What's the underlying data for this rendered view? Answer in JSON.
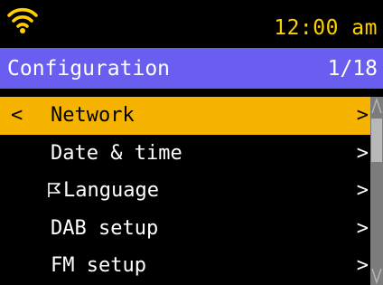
{
  "status_bar": {
    "time": "12:00 am",
    "wifi_icon": "wifi-icon"
  },
  "header": {
    "title": "Configuration",
    "page_indicator": "1/18"
  },
  "menu": {
    "back_glyph": "<",
    "item_arrow": ">",
    "items": [
      {
        "label": "Network",
        "selected": true
      },
      {
        "label": "Date & time",
        "selected": false
      },
      {
        "label": "Language",
        "selected": false,
        "icon": "flag-icon"
      },
      {
        "label": "DAB setup",
        "selected": false
      },
      {
        "label": "FM setup",
        "selected": false
      }
    ]
  },
  "colors": {
    "background": "#000000",
    "accent_clock": "#ffd000",
    "title_bar": "#6a5ef0",
    "selection": "#f5b300",
    "scrollbar_track": "#7c7c7c",
    "scrollbar_thumb": "#b8b8b8"
  }
}
